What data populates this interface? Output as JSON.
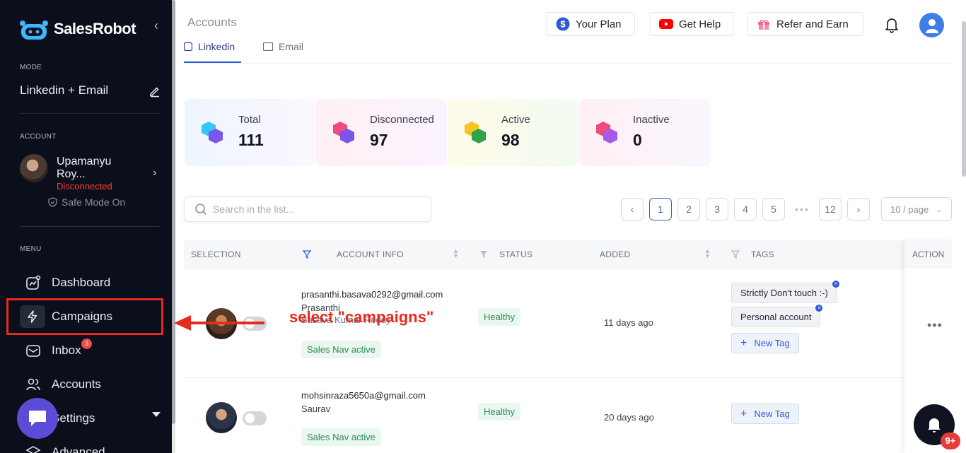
{
  "sidebar": {
    "brand": "SalesRobot",
    "mode_label": "MODE",
    "mode_value": "Linkedin + Email",
    "account_label": "ACCOUNT",
    "account_name": "Upamanyu Roy...",
    "account_status": "Disconnected",
    "safe_mode": "Safe Mode On",
    "menu_label": "MENU",
    "menu": [
      {
        "label": "Dashboard"
      },
      {
        "label": "Campaigns"
      },
      {
        "label": "Inbox",
        "badge": "3"
      },
      {
        "label": "Accounts"
      },
      {
        "label": "Settings"
      },
      {
        "label": "Advanced"
      }
    ]
  },
  "header": {
    "title": "Accounts",
    "your_plan": "Your Plan",
    "get_help": "Get Help",
    "refer": "Refer and Earn"
  },
  "tabs": [
    {
      "label": "Linkedin"
    },
    {
      "label": "Email"
    }
  ],
  "stats": [
    {
      "label": "Total",
      "value": "111"
    },
    {
      "label": "Disconnected",
      "value": "97"
    },
    {
      "label": "Active",
      "value": "98"
    },
    {
      "label": "Inactive",
      "value": "0"
    }
  ],
  "search": {
    "placeholder": "Search in the list..."
  },
  "pagination": {
    "pages": [
      "1",
      "2",
      "3",
      "4",
      "5",
      "12"
    ],
    "current": "1",
    "per_page": "10 / page"
  },
  "table": {
    "columns": [
      "SELECTION",
      "ACCOUNT INFO",
      "STATUS",
      "ADDED",
      "TAGS",
      "ACTION"
    ],
    "rows": [
      {
        "email": "prasanthi.basava0292@gmail.com",
        "name": "Prasanthi",
        "sub": "Basava Kumar Reddy",
        "sales_nav": "Sales Nav active",
        "status": "Healthy",
        "added": "11 days ago",
        "tags": [
          "Strictly Don't touch :-)",
          "Personal account"
        ],
        "new_tag": "New Tag"
      },
      {
        "email": "mohsinraza5650a@gmail.com",
        "name": "Saurav",
        "sales_nav": "Sales Nav active",
        "status": "Healthy",
        "added": "20 days ago",
        "tags": [],
        "new_tag": "New Tag"
      }
    ]
  },
  "annotation": {
    "text": "select \"campaigns\""
  },
  "notifications": {
    "badge": "9+"
  }
}
